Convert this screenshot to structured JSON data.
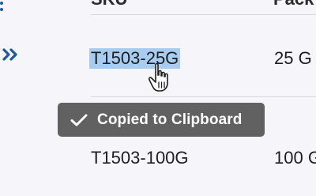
{
  "table": {
    "headers": {
      "sku": "SKU",
      "pack": "Pack Size"
    },
    "rows": [
      {
        "sku": "T1503-25G",
        "pack": "25 G"
      },
      {
        "sku": "T1503-100G",
        "pack": "100 G"
      }
    ]
  },
  "expand_icon": "double-chevron-right-icon",
  "cursor_icon": "hand-pointer-icon",
  "toast": {
    "icon": "checkmark-icon",
    "message": "Copied to Clipboard"
  },
  "colors": {
    "link_blue": "#1d5a9c",
    "selection": "#a8cdf3",
    "toast_bg": "#616161",
    "background": "#f6f6fa"
  }
}
